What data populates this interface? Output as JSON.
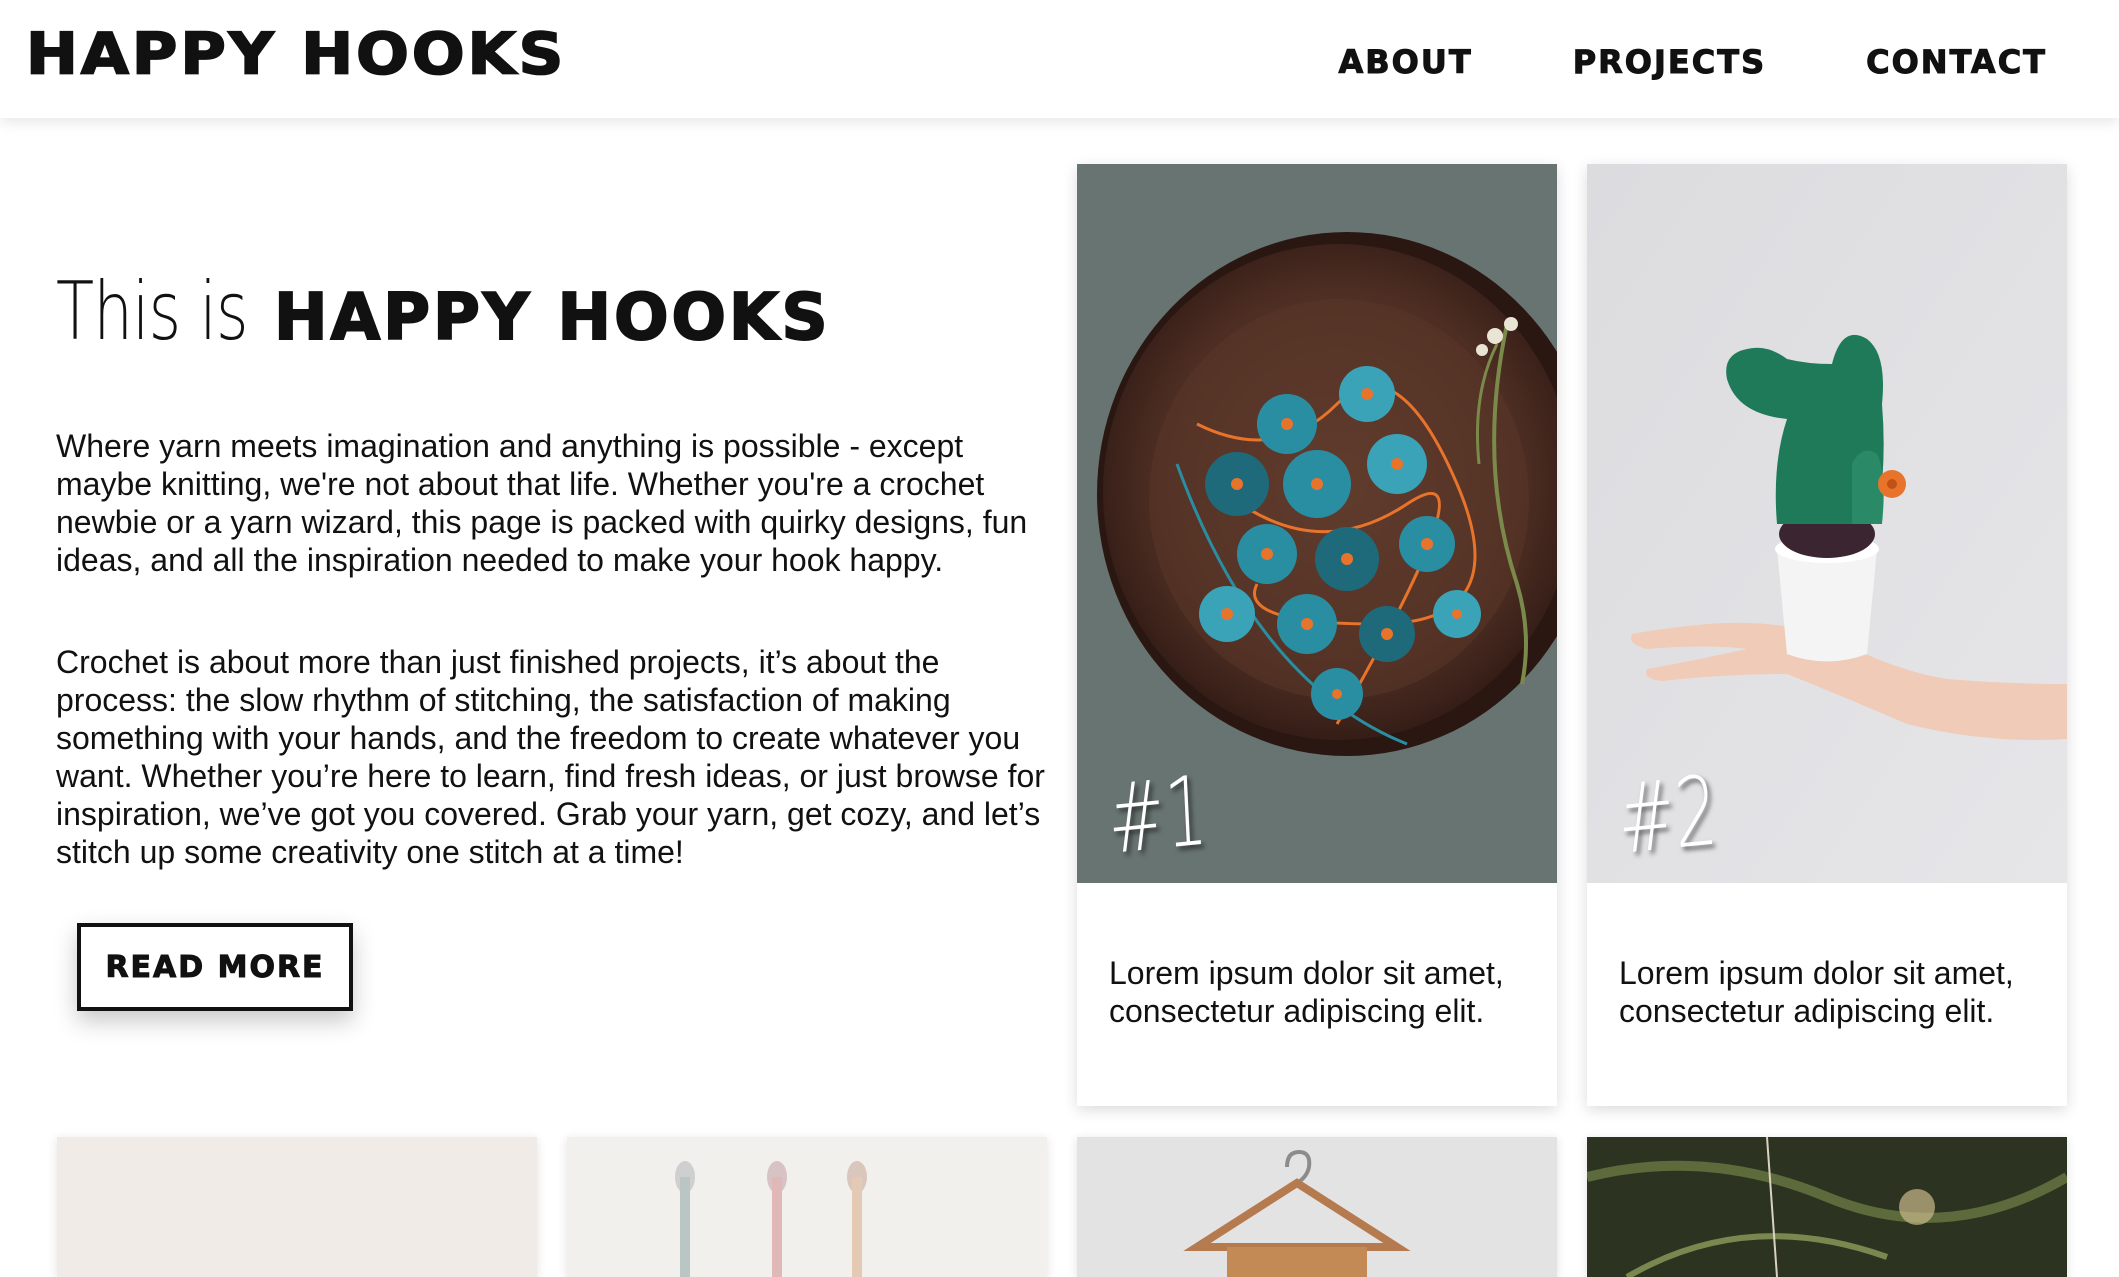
{
  "header": {
    "brand": "HAPPY HOOKS",
    "nav": [
      "ABOUT",
      "PROJECTS",
      "CONTACT"
    ]
  },
  "hero": {
    "title_prefix": "This is",
    "title_name": "HAPPY HOOKS",
    "paragraphs": [
      "Where yarn meets imagination and anything is possible - except maybe knitting, we're not about that life. Whether you're a crochet newbie or a yarn wizard, this page is packed with quirky designs, fun ideas, and all the inspiration needed to make your hook happy.",
      "Crochet is about more than just finished projects, it’s about the process: the slow rhythm of stitching, the satisfaction of making something with your hands, and the freedom to create whatever you want. Whether you’re here to learn, find fresh ideas, or just browse for inspiration, we’ve got you covered. Grab your yarn, get cozy, and let’s stitch up some creativity one stitch at a time!"
    ],
    "cta_label": "READ MORE"
  },
  "projects": [
    {
      "number": "#1",
      "image": "crochet-flowers-bowl-photo",
      "text": "Lorem ipsum dolor sit amet, consectetur adipiscing elit."
    },
    {
      "number": "#2",
      "image": "crochet-cactus-on-hand-photo",
      "text": "Lorem ipsum dolor sit amet, consectetur adipiscing elit."
    }
  ],
  "thumbnails": [
    "fluffy-white-photo",
    "yarn-skeins-photo",
    "hanger-photo",
    "pine-branch-photo"
  ],
  "colors": {
    "text": "#111111",
    "background": "#ffffff",
    "teal_yarn": "#2a8ea3",
    "orange_yarn": "#e8742b",
    "cactus_green": "#1f7a5a"
  }
}
